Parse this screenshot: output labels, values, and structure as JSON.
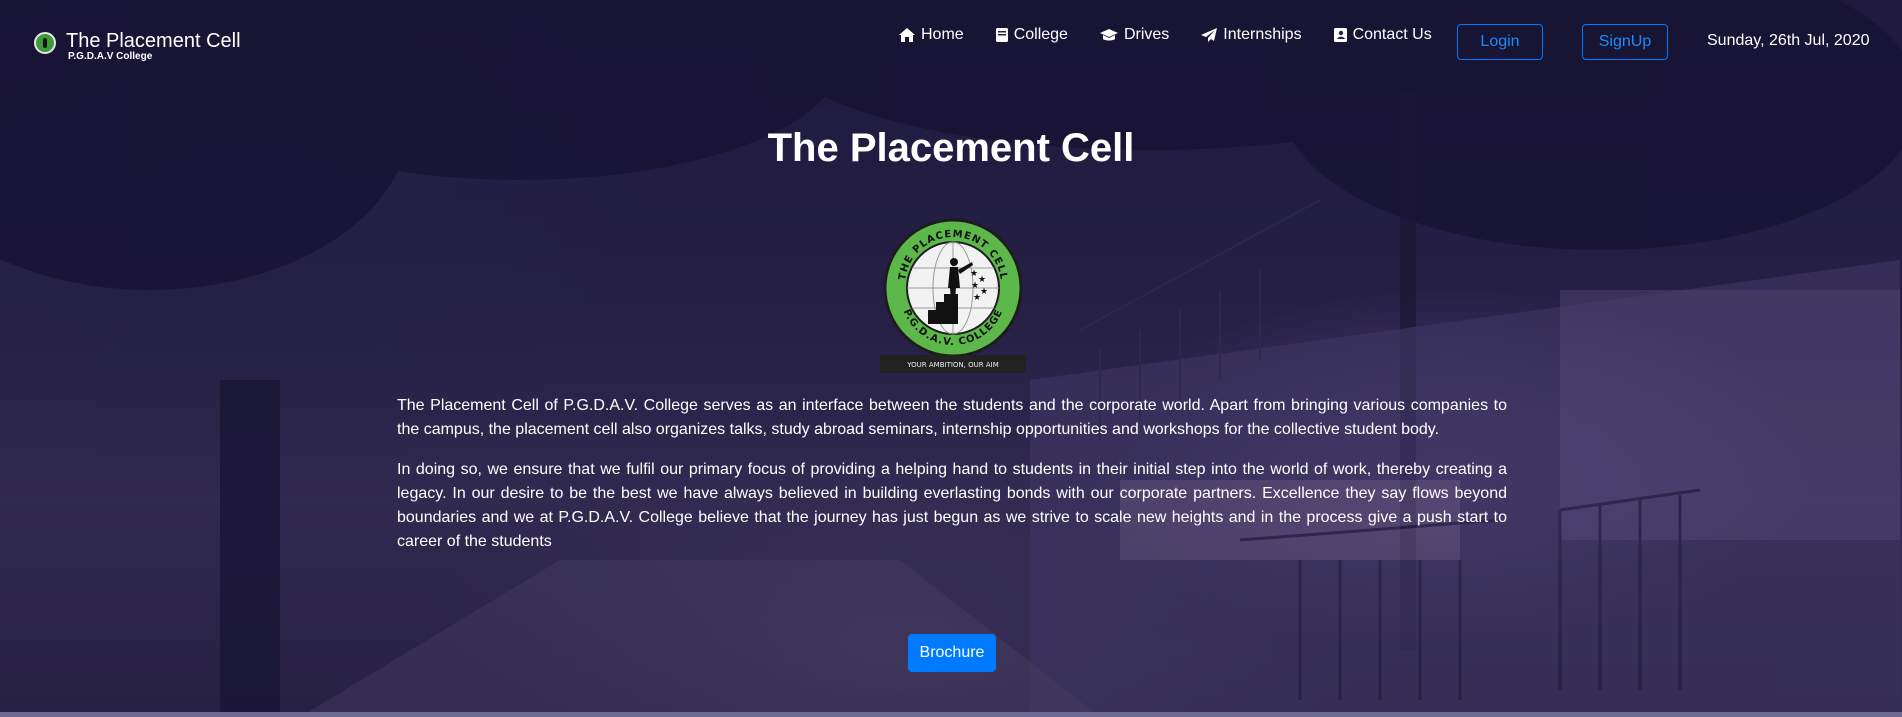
{
  "brand": {
    "title": "The Placement Cell",
    "subtitle": "P.G.D.A.V College",
    "icon": "college-logo-icon"
  },
  "nav": {
    "links": [
      {
        "label": "Home",
        "icon": "home-icon"
      },
      {
        "label": "College",
        "icon": "book-icon"
      },
      {
        "label": "Drives",
        "icon": "graduation-cap-icon"
      },
      {
        "label": "Internships",
        "icon": "paper-plane-icon"
      },
      {
        "label": "Contact Us",
        "icon": "address-book-icon"
      }
    ],
    "login_label": "Login",
    "signup_label": "SignUp",
    "date": "Sunday, 26th Jul, 2020"
  },
  "hero": {
    "title": "The Placement Cell",
    "emblem_text_top": "THE PLACEMENT CELL",
    "emblem_text_bottom": "P.G.D.A.V. COLLEGE",
    "emblem_tagline": "YOUR AMBITION, OUR AIM",
    "paragraph_1": "The Placement Cell of P.G.D.A.V. College serves as an interface between the students and the corporate world. Apart from bringing various companies to the campus, the placement cell also organizes talks, study abroad seminars, internship opportunities and workshops for the collective student body.",
    "paragraph_2": "In doing so, we ensure that we fulfil our primary focus of providing a helping hand to students in their initial step into the world of work, thereby creating a legacy. In our desire to be the best we have always believed in building everlasting bonds with our corporate partners. Excellence they say flows beyond boundaries and we at P.G.D.A.V. College believe that the journey has just begun as we strive to scale new heights and in the process give a push start to career of the students",
    "brochure_label": "Brochure"
  },
  "colors": {
    "primary": "#007bff",
    "emblem_green": "#5cb84a",
    "overlay": "#221f3d"
  }
}
